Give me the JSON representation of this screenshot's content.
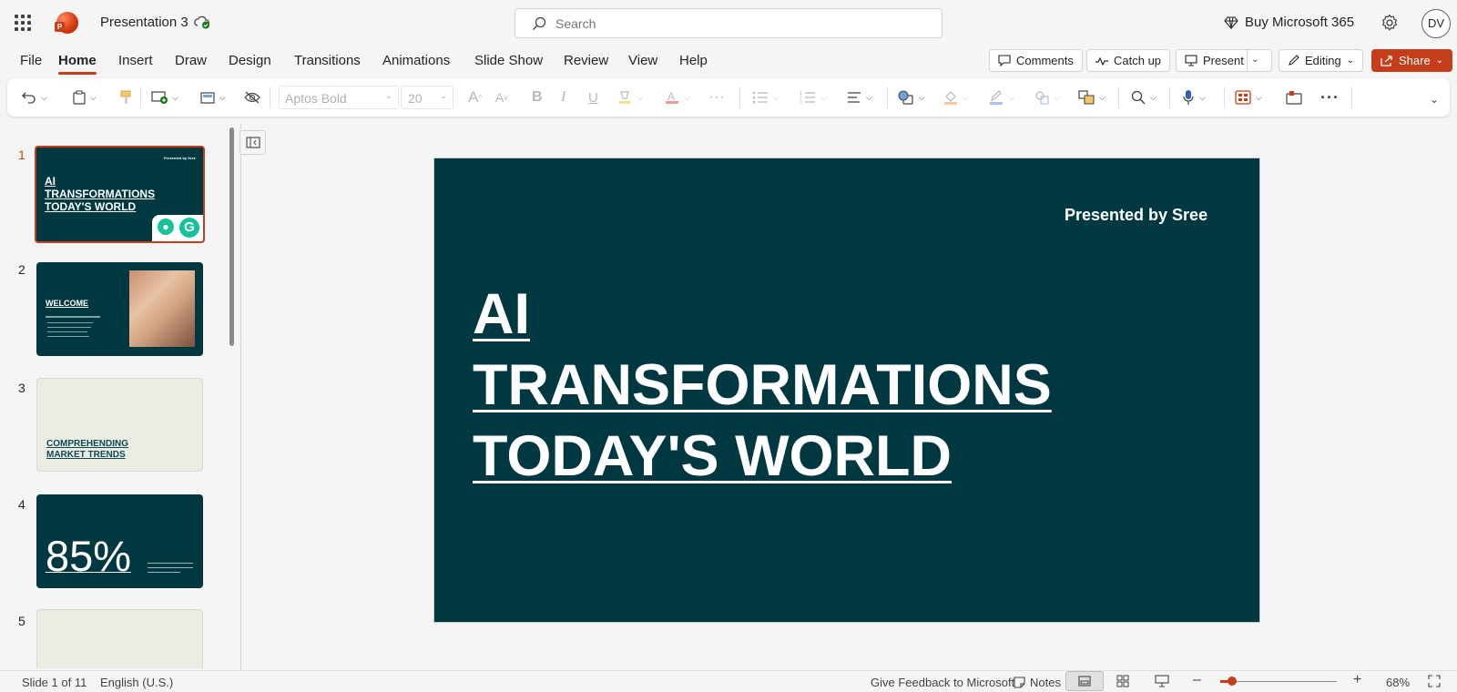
{
  "app": {
    "title": "Presentation 3",
    "search_placeholder": "Search",
    "buy_label": "Buy Microsoft 365",
    "avatar_initials": "DV"
  },
  "tabs": [
    {
      "label": "File"
    },
    {
      "label": "Home",
      "active": true
    },
    {
      "label": "Insert"
    },
    {
      "label": "Draw"
    },
    {
      "label": "Design"
    },
    {
      "label": "Transitions"
    },
    {
      "label": "Animations"
    },
    {
      "label": "Slide Show"
    },
    {
      "label": "Review"
    },
    {
      "label": "View"
    },
    {
      "label": "Help"
    }
  ],
  "actions": {
    "comments": "Comments",
    "catchup": "Catch up",
    "present": "Present",
    "editing": "Editing",
    "share": "Share"
  },
  "ribbon": {
    "font_name": "Aptos Bold",
    "font_size": "20"
  },
  "slides": [
    {
      "number": "1",
      "presented_by": "Presented by Sree",
      "title_lines": [
        "AI",
        "TRANSFORMATIONS",
        "TODAY'S WORLD"
      ]
    },
    {
      "number": "2",
      "title": "WELCOME"
    },
    {
      "number": "3",
      "title_lines": [
        "COMPREHENDING",
        "MARKET TRENDS"
      ]
    },
    {
      "number": "4",
      "stat": "85%"
    },
    {
      "number": "5"
    }
  ],
  "main_slide": {
    "presented_by": "Presented by  Sree",
    "title_line1": "AI ",
    "title_line2": "TRANSFORMATIONS ",
    "title_line3": "TODAY'S WORLD"
  },
  "status": {
    "slide_count": "Slide 1 of 11",
    "language": "English (U.S.)",
    "feedback": "Give Feedback to Microsoft",
    "notes": "Notes",
    "zoom": "68%",
    "zoom_fraction": 0.1
  },
  "colors": {
    "accent": "#c43e1c",
    "slide_bg": "#003841",
    "beige_slide": "#ecebe4"
  }
}
